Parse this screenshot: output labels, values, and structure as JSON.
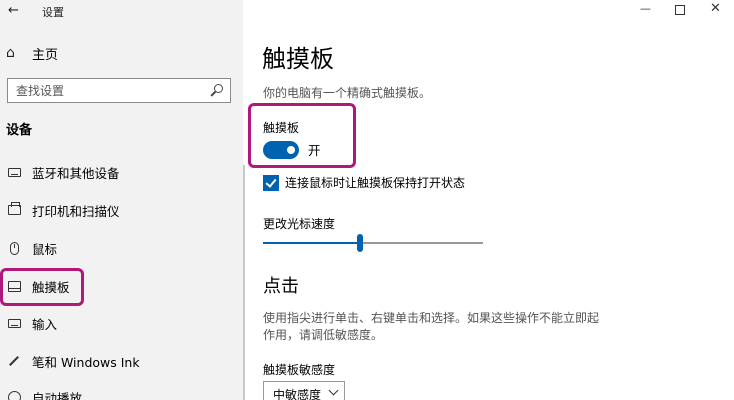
{
  "window": {
    "title": "设置",
    "back_icon": "back-arrow-icon",
    "minimize": "—",
    "close": "✕"
  },
  "sidebar": {
    "home_label": "主页",
    "search_placeholder": "查找设置",
    "section_header": "设备",
    "items": [
      {
        "label": "蓝牙和其他设备",
        "icon": "keyboard-icon"
      },
      {
        "label": "打印机和扫描仪",
        "icon": "printer-icon"
      },
      {
        "label": "鼠标",
        "icon": "mouse-icon"
      },
      {
        "label": "触摸板",
        "icon": "touchpad-icon",
        "active": true
      },
      {
        "label": "输入",
        "icon": "keyboard-icon"
      },
      {
        "label": "笔和 Windows Ink",
        "icon": "pen-icon"
      },
      {
        "label": "自动播放",
        "icon": "autoplay-icon"
      }
    ]
  },
  "main": {
    "title": "触摸板",
    "description": "你的电脑有一个精确式触摸板。",
    "touchpad_label": "触摸板",
    "toggle_state": "开",
    "toggle_on": true,
    "checkbox_label": "连接鼠标时让触摸板保持打开状态",
    "checkbox_checked": true,
    "speed_label": "更改光标速度",
    "speed_value": 0.44,
    "tap_header": "点击",
    "tap_description": "使用指尖进行单击、右键单击和选择。如果这些操作不能立即起作用，请调低敏感度。",
    "sensitivity_label": "触摸板敏感度",
    "sensitivity_value": "中敏感度"
  },
  "colors": {
    "accent": "#0063b1",
    "highlight": "#b0197a"
  }
}
